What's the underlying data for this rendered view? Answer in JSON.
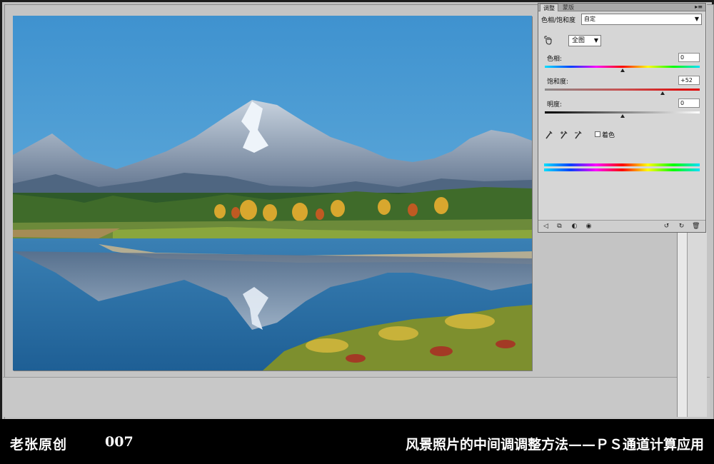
{
  "panel": {
    "tab_adjust": "调整",
    "tab_mask": "蒙版",
    "menu_icon": "menu-icon",
    "preset_label": "色相/饱和度",
    "preset_value": "自定",
    "range_value": "全图",
    "sliders": [
      {
        "label": "色相:",
        "value": "0",
        "level": 0.5
      },
      {
        "label": "饱和度:",
        "value": "+52",
        "level": 0.76
      },
      {
        "label": "明度:",
        "value": "0",
        "level": 0.5
      }
    ],
    "colorize_label": "着色",
    "colorize_checked": false
  },
  "caption": {
    "author": "老张原创",
    "number": "007",
    "title": "风景照片的中间调调整方法——ＰＳ通道计算应用"
  },
  "colors": {
    "workspace": "#c0c0c0",
    "panel": "#d6d6d6",
    "caption_bg": "#000000",
    "caption_text": "#ffffff"
  }
}
